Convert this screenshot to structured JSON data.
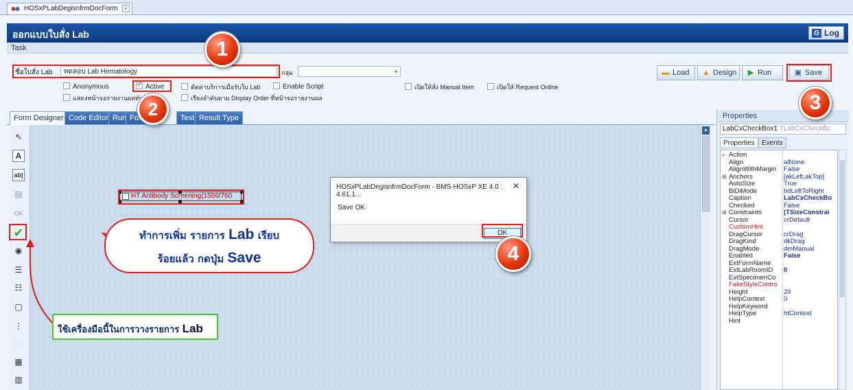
{
  "document_tab": {
    "label": "HOSxPLabDegisnfrmDocForm",
    "close_glyph": "×"
  },
  "header": {
    "title": "ออกแบบใบสั่ง Lab",
    "log_button": "Log",
    "log_icon_glyph": "G"
  },
  "task_label": "Task",
  "form": {
    "lab_name_label": "ชื่อใบสั่ง Lab",
    "lab_name_value": "ทดสอบ Lab Hematology",
    "group_label": "กลุ่ม",
    "group_value": "",
    "checkboxes": [
      {
        "label": "Anonymous",
        "checked": false
      },
      {
        "label": "Active",
        "checked": true
      },
      {
        "label": "ตัดค่าบริการเมื่อรับใบ Lab",
        "checked": false
      },
      {
        "label": "Enable Script",
        "checked": false
      },
      {
        "label": "เปิดให้สั่ง Manual Item",
        "checked": false
      },
      {
        "label": "เปิดให้ Request Online",
        "checked": false
      },
      {
        "label": "แสดงหน้าจอรายงานผลทันที",
        "checked": false
      },
      {
        "label": "เรียงลำดับตาม Display Order ที่หน้าจอรายงานผล",
        "checked": false
      }
    ]
  },
  "toolbar": {
    "load": "Load",
    "design": "Design",
    "run": "Run",
    "save": "Save"
  },
  "designer_tabs": [
    "Form Designer",
    "Code Editor",
    "Run",
    "For",
    "Test",
    "Result Type"
  ],
  "canvas": {
    "checkbox_caption": "HT Antibody Screening(1556/760"
  },
  "dialog": {
    "title": "HOSxPLabDegisnfrmDocForm - BMS-HOSxP XE 4.0 : 4.61.1...",
    "close_glyph": "✕",
    "message": "Save OK",
    "ok": "OK"
  },
  "properties": {
    "heading": "Properties",
    "selected_component": "LabCxCheckBox1",
    "selected_type": "TLabCxCheckBc",
    "tabs": [
      "Properties",
      "Events"
    ],
    "rows": [
      {
        "name": "Action",
        "value": "",
        "expand": "»"
      },
      {
        "name": "Align",
        "value": "alNone"
      },
      {
        "name": "AlignWithMargin",
        "value": "False"
      },
      {
        "name": "Anchors",
        "value": "[akLeft,akTop]",
        "expand": "⊞"
      },
      {
        "name": "AutoSize",
        "value": "True"
      },
      {
        "name": "BiDiMode",
        "value": "bdLeftToRight"
      },
      {
        "name": "Caption",
        "value": "LabCxCheckBo",
        "bold": true
      },
      {
        "name": "Checked",
        "value": "False"
      },
      {
        "name": "Constraints",
        "value": "(TSizeConstrai",
        "bold": true,
        "expand": "⊞"
      },
      {
        "name": "Cursor",
        "value": "crDefault"
      },
      {
        "name": "CustomHint",
        "value": "",
        "red": true
      },
      {
        "name": "DragCursor",
        "value": "crDrag"
      },
      {
        "name": "DragKind",
        "value": "dkDrag"
      },
      {
        "name": "DragMode",
        "value": "dmManual"
      },
      {
        "name": "Enabled",
        "value": "False",
        "bold": true
      },
      {
        "name": "ExtFormName",
        "value": ""
      },
      {
        "name": "ExtLabRoomID",
        "value": "0",
        "bold": true
      },
      {
        "name": "ExtSpecimenCo",
        "value": ""
      },
      {
        "name": "FakeStyleContro",
        "value": "",
        "red": true
      },
      {
        "name": "Height",
        "value": "20"
      },
      {
        "name": "HelpContext",
        "value": "0"
      },
      {
        "name": "HelpKeyword",
        "value": ""
      },
      {
        "name": "HelpType",
        "value": "htContext"
      },
      {
        "name": "Hint",
        "value": ""
      }
    ]
  },
  "annotations": {
    "step1": "1",
    "step2": "2",
    "step3": "3",
    "step4": "4",
    "callout_line1_prefix": "ทำการเพิ่ม รายการ ",
    "callout_line1_lab": "Lab",
    "callout_line1_suffix": " เรียบ",
    "callout_line2_prefix": "ร้อยแล้ว กดปุ่ม ",
    "callout_line2_save": "Save",
    "tool_note_prefix": "ใช้เครื่องมือนี้ในการวางรายการ ",
    "tool_note_lab": "Lab"
  },
  "colors": {
    "title_bar": "#0d3a80",
    "highlight_red": "#e0211b",
    "highlight_green": "#4ac82c",
    "callout_text": "#0a2f9c",
    "canvas_caption": "#c10000"
  }
}
